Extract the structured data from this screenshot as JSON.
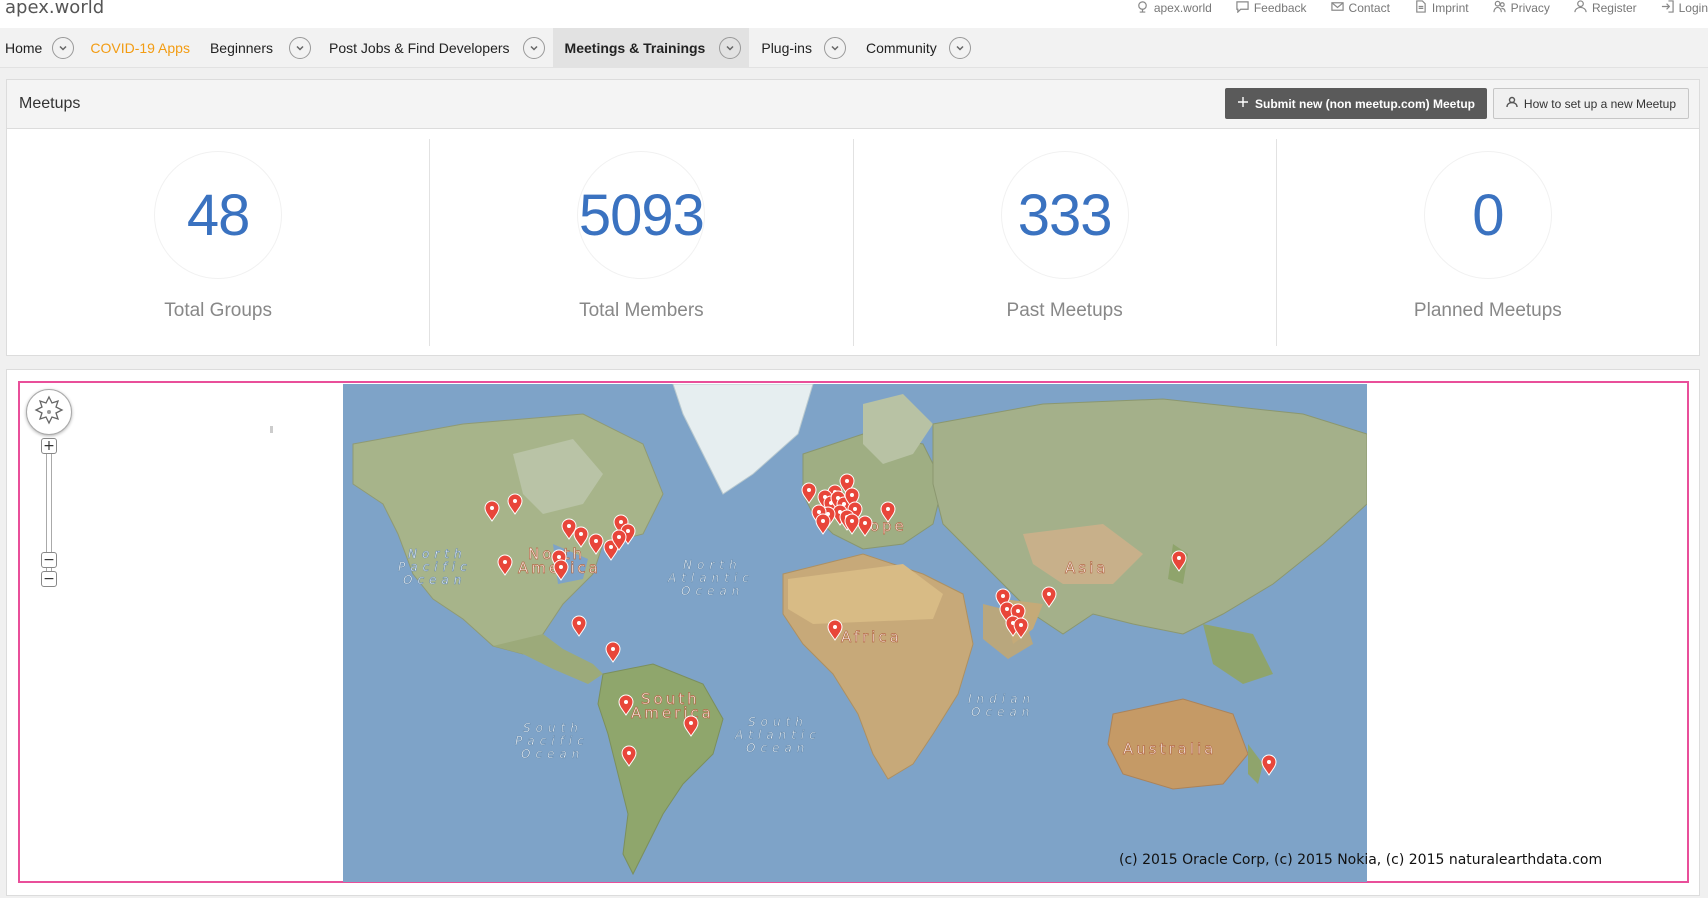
{
  "brand": "apex.world",
  "top_links": [
    {
      "label": "apex.world",
      "icon": "globe-icon"
    },
    {
      "label": "Feedback",
      "icon": "comment-icon"
    },
    {
      "label": "Contact",
      "icon": "mail-icon"
    },
    {
      "label": "Imprint",
      "icon": "document-icon"
    },
    {
      "label": "Privacy",
      "icon": "users-icon"
    },
    {
      "label": "Register",
      "icon": "user-icon"
    },
    {
      "label": "Login",
      "icon": "login-icon"
    }
  ],
  "nav": {
    "items": [
      {
        "label": "Home"
      },
      {
        "label": "COVID-19 Apps"
      },
      {
        "label": "Beginners"
      },
      {
        "label": "Post Jobs & Find Developers"
      },
      {
        "label": "Meetings & Trainings"
      },
      {
        "label": "Plug-ins"
      },
      {
        "label": "Community"
      }
    ],
    "active": "Meetings & Trainings",
    "highlight_color": "#f39c12"
  },
  "meetups": {
    "title": "Meetups",
    "submit_button": "Submit new (non meetup.com) Meetup",
    "howto_button": "How to set up a new Meetup",
    "stats": [
      {
        "value": "48",
        "label": "Total Groups"
      },
      {
        "value": "5093",
        "label": "Total Members"
      },
      {
        "value": "333",
        "label": "Past Meetups"
      },
      {
        "value": "0",
        "label": "Planned Meetups"
      }
    ],
    "accent_color": "#3a72c0"
  },
  "map": {
    "copyright": "(c) 2015 Oracle Corp, (c) 2015 Nokia, (c) 2015 naturalearthdata.com",
    "zoom_in": "+",
    "zoom_out": "−",
    "labels": {
      "north_america": [
        "North",
        "America"
      ],
      "south_america": [
        "South",
        "America"
      ],
      "europe": "rope",
      "africa": "Africa",
      "asia": "Asia",
      "australia": "Australia",
      "north_pacific": [
        "North",
        "Pacific",
        "Ocean"
      ],
      "south_pacific": [
        "South",
        "Pacific",
        "Ocean"
      ],
      "north_atlantic": [
        "North",
        "Atlantic",
        "Ocean"
      ],
      "south_atlantic": [
        "South",
        "Atlantic",
        "Ocean"
      ],
      "indian": [
        "Indian",
        "Ocean"
      ]
    },
    "marker_color": "#e8463a",
    "frame_color": "#e94f9a"
  }
}
